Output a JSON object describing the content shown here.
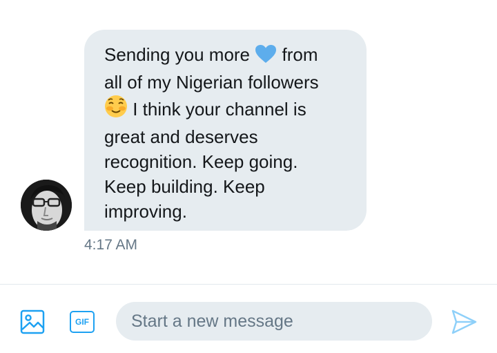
{
  "message": {
    "lines": [
      {
        "before": "Sending you more",
        "emoji": "blue-heart-icon",
        "after": "from"
      },
      {
        "text": "all of my Nigerian followers"
      },
      {
        "emoji": "smiling-face-icon",
        "after": "I think your channel is"
      },
      {
        "text": "great and deserves"
      },
      {
        "text": "recognition. Keep going."
      },
      {
        "text": "Keep building. Keep"
      },
      {
        "text": "improving."
      }
    ],
    "timestamp": "4:17 AM"
  },
  "composer": {
    "placeholder": "Start a new message",
    "gif_label": "GIF",
    "media_icon": "image-icon",
    "send_icon": "send-icon"
  },
  "colors": {
    "bubble": "#e6ecf0",
    "accent": "#1da1f2",
    "heart": "#5dadec",
    "muted_text": "#657786"
  }
}
